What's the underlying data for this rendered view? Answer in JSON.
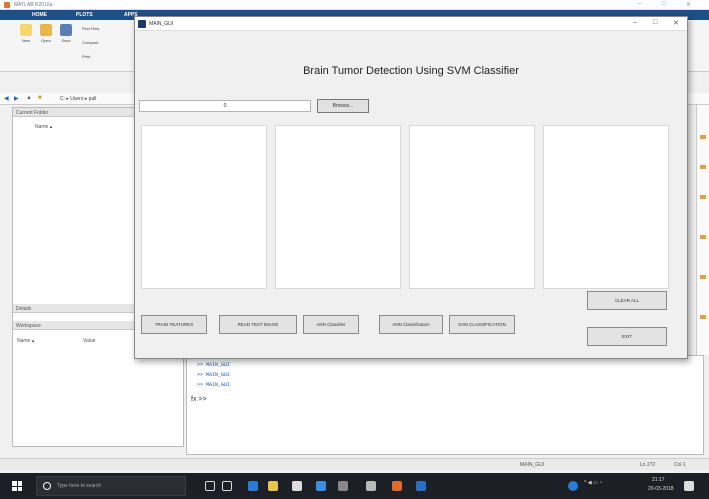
{
  "matlab": {
    "window_title": "MATLAB R2016a",
    "tabs": [
      "HOME",
      "PLOTS",
      "APPS"
    ],
    "ribbon": {
      "new_label": "New",
      "open_label": "Open",
      "save_label": "Save",
      "find_files": "Find Files",
      "compare": "Compare",
      "print": "Print"
    },
    "address_path": "C: ▸ Users ▸ pall",
    "current_folder_label": "Current Folder",
    "name_column": "Name ▴",
    "details_label": "Details",
    "workspace_label": "Workspace",
    "ws_name_col": "Name ▴",
    "ws_value_col": "Value",
    "command_lines": [
      ">> MAIN_GUI",
      ">> MAIN_GUI",
      ">> MAIN_GUI"
    ],
    "prompt": "fx >>",
    "status_left": "",
    "status_script": "MAIN_GUI",
    "status_ln": "Ln 272",
    "status_col": "Col 1"
  },
  "gui": {
    "window_title": "MAIN_GUI",
    "heading": "Brain Tumor Detection Using SVM Classifier",
    "path_value": "0",
    "browse_label": "Browse...",
    "buttons": {
      "train": "TRAIN FEATURES",
      "read": "READ TEST IMAGE",
      "ann": "ANN Classifier",
      "ann_class": "ANN Classification",
      "svm_class": "SVM CLASSIFICATION",
      "clear": "CLEAR ALL",
      "exit": "EXIT"
    }
  },
  "taskbar": {
    "search_placeholder": "Type here to search",
    "time": "21:17",
    "date": "20-03-2018"
  },
  "colors": {
    "matlab_tab_bar": "#1f4e8c",
    "taskbar": "#1d1f26"
  }
}
